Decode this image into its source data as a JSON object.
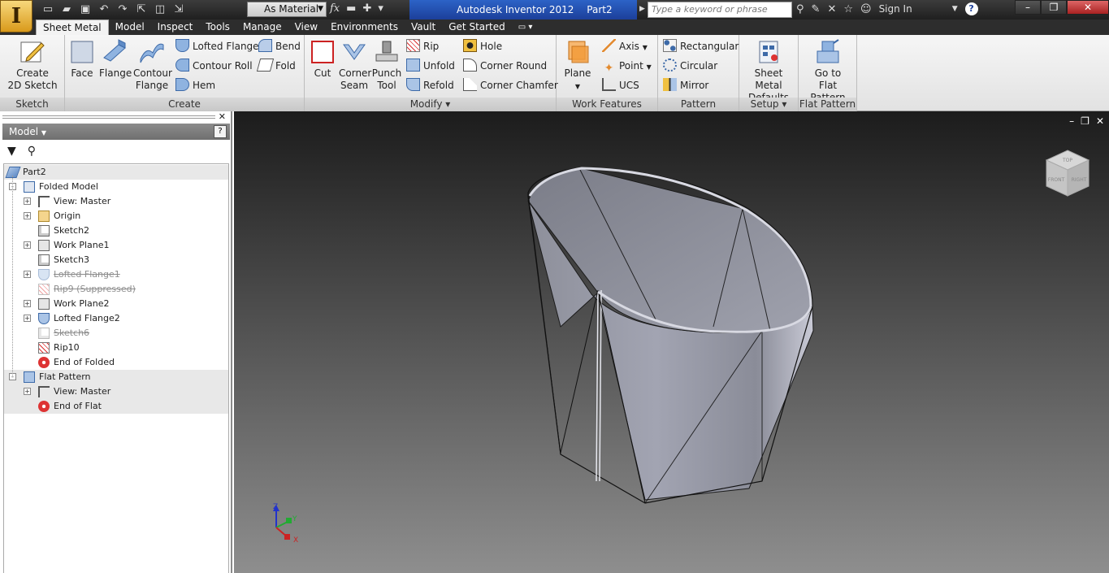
{
  "titlebar": {
    "app_title": "Autodesk Inventor 2012",
    "doc_name": "Part2",
    "material": "As Material",
    "search_placeholder": "Type a keyword or phrase",
    "sign_in": "Sign In"
  },
  "tabs": [
    {
      "label": "Sheet Metal",
      "active": true
    },
    {
      "label": "Model"
    },
    {
      "label": "Inspect"
    },
    {
      "label": "Tools"
    },
    {
      "label": "Manage"
    },
    {
      "label": "View"
    },
    {
      "label": "Environments"
    },
    {
      "label": "Vault"
    },
    {
      "label": "Get Started"
    }
  ],
  "ribbon": {
    "sketch": {
      "title": "Sketch",
      "create_2d": [
        "Create",
        "2D Sketch"
      ]
    },
    "create": {
      "title": "Create",
      "face": "Face",
      "flange": "Flange",
      "contour_flange": [
        "Contour",
        "Flange"
      ],
      "lofted_flange": "Lofted Flange",
      "contour_roll": "Contour Roll",
      "hem": "Hem",
      "bend": "Bend",
      "fold": "Fold"
    },
    "modify": {
      "title": "Modify",
      "cut": "Cut",
      "corner_seam": [
        "Corner",
        "Seam"
      ],
      "punch_tool": [
        "Punch",
        "Tool"
      ],
      "rip": "Rip",
      "unfold": "Unfold",
      "refold": "Refold",
      "hole": "Hole",
      "corner_round": "Corner Round",
      "corner_chamfer": "Corner Chamfer"
    },
    "work_features": {
      "title": "Work Features",
      "plane": "Plane",
      "axis": "Axis",
      "point": "Point",
      "ucs": "UCS"
    },
    "pattern": {
      "title": "Pattern",
      "rectangular": "Rectangular",
      "circular": "Circular",
      "mirror": "Mirror"
    },
    "setup": {
      "title": "Setup",
      "sm_defaults": [
        "Sheet Metal",
        "Defaults"
      ]
    },
    "flat_pattern": {
      "title": "Flat Pattern",
      "go_to": [
        "Go to",
        "Flat Pattern"
      ]
    }
  },
  "browser": {
    "title": "Model",
    "help": "?",
    "nodes": [
      {
        "label": "Part2",
        "level": 0,
        "icon": "part-icon",
        "exp": ""
      },
      {
        "label": "Folded Model",
        "level": 1,
        "icon": "folded-model-icon",
        "exp": "-"
      },
      {
        "label": "View: Master",
        "level": 2,
        "icon": "view-icon",
        "exp": "+"
      },
      {
        "label": "Origin",
        "level": 2,
        "icon": "folder-icon",
        "exp": "+"
      },
      {
        "label": "Sketch2",
        "level": 2,
        "icon": "sketch-icon",
        "exp": ""
      },
      {
        "label": "Work Plane1",
        "level": 2,
        "icon": "work-plane-icon",
        "exp": "+"
      },
      {
        "label": "Sketch3",
        "level": 2,
        "icon": "sketch-icon",
        "exp": ""
      },
      {
        "label": "Lofted Flange1",
        "level": 2,
        "icon": "lofted-flange-icon",
        "exp": "+",
        "suppressed": true
      },
      {
        "label": "Rip9 (Suppressed)",
        "level": 2,
        "icon": "rip-icon",
        "exp": "",
        "suppressed": true
      },
      {
        "label": "Work Plane2",
        "level": 2,
        "icon": "work-plane-icon",
        "exp": "+"
      },
      {
        "label": "Lofted Flange2",
        "level": 2,
        "icon": "lofted-flange-icon",
        "exp": "+"
      },
      {
        "label": "Sketch6",
        "level": 2,
        "icon": "sketch-icon",
        "exp": "",
        "suppressed": true
      },
      {
        "label": "Rip10",
        "level": 2,
        "icon": "rip-icon",
        "exp": ""
      },
      {
        "label": "End of Folded",
        "level": 2,
        "icon": "end-of-part-icon",
        "exp": ""
      },
      {
        "label": "Flat Pattern",
        "level": 1,
        "icon": "flat-pattern-icon",
        "exp": "-"
      },
      {
        "label": "View: Master",
        "level": 2,
        "icon": "view-icon",
        "exp": "+"
      },
      {
        "label": "End of Flat",
        "level": 2,
        "icon": "end-of-part-icon",
        "exp": ""
      }
    ]
  },
  "viewcube": {
    "top": "TOP",
    "front": "FRONT",
    "right": "RIGHT"
  },
  "triad": {
    "x": "X",
    "y": "Y",
    "z": "Z"
  },
  "colors": {
    "accent": "#2c63c7",
    "tab_bar": "#2d2d2d",
    "viewport_top": "#1c1c1c",
    "viewport_bottom": "#8e8e8e"
  }
}
